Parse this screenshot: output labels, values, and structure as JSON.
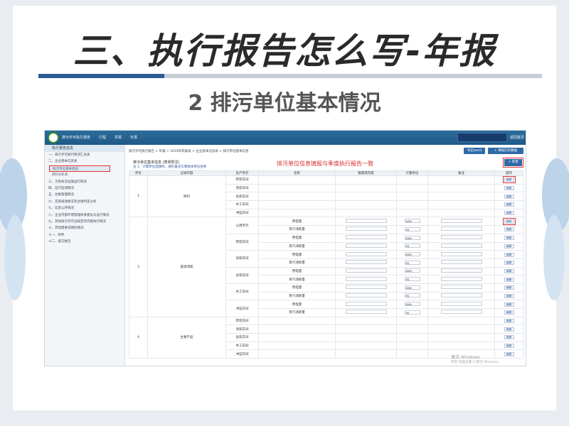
{
  "slide": {
    "title": "三、执行报告怎么写-年报",
    "subtitle": "2 排污单位基本情况"
  },
  "app": {
    "name": "排污许可执行报告",
    "nav": [
      "行程",
      "举报",
      "年报"
    ],
    "exit": "返回首页"
  },
  "sidebar": {
    "head": "执行报告信息",
    "items": [
      {
        "label": "一、排污许可执行情况汇总表",
        "sub": false,
        "selected": false
      },
      {
        "label": "二、企业基本信息表",
        "sub": false,
        "selected": false
      },
      {
        "label": "排污单位基本情况",
        "sub": true,
        "selected": true
      },
      {
        "label": "原料分析表",
        "sub": true,
        "selected": false
      },
      {
        "label": "三、污染防治设施运行情况",
        "sub": false,
        "selected": false
      },
      {
        "label": "四、自行监测情况",
        "sub": false,
        "selected": false
      },
      {
        "label": "五、台账管理情况",
        "sub": false,
        "selected": false
      },
      {
        "label": "六、实际排放情况及合规判定分析",
        "sub": false,
        "selected": false
      },
      {
        "label": "七、信息公开情况",
        "sub": false,
        "selected": false
      },
      {
        "label": "八、企业内部环境管理体系建设与运行情况",
        "sub": false,
        "selected": false
      },
      {
        "label": "九、其他排污许可证规定的内容执行情况",
        "sub": false,
        "selected": false
      },
      {
        "label": "十、其他需要说明的情况",
        "sub": false,
        "selected": false
      },
      {
        "label": "十一、附件",
        "sub": false,
        "selected": false
      },
      {
        "label": "十二、提交报告",
        "sub": false,
        "selected": false
      }
    ]
  },
  "content": {
    "breadcrumb": "排污许可执行报告 > 年报 > 2019年年报表 > 企业基本信息表 > 排污单位基本信息",
    "export_label": "导出word",
    "history_label": "+ 填报历史数据",
    "form_title": "排污单位基本信息 (表单附注)",
    "form_note": "注 1：计量单位选择时，请在备注写明具体单位名称",
    "annotation": "排污单位信息填报与季度执行报告一致",
    "add_label": "+ 新增",
    "headers": [
      "序号",
      "记录内容",
      "生产单元",
      "名称",
      "数量或内容",
      "计量单位",
      "备注",
      "操作"
    ],
    "edit_label": "编辑",
    "groups": [
      {
        "no": "1",
        "content": "原料",
        "units": [
          {
            "name": "焊装车间",
            "rows": [
              {
                "item": "",
                "unit": ""
              }
            ]
          },
          {
            "name": "涂装车间",
            "rows": [
              {
                "item": "",
                "unit": ""
              }
            ]
          },
          {
            "name": "总装车间",
            "rows": [
              {
                "item": "",
                "unit": ""
              }
            ]
          },
          {
            "name": "木工车间",
            "rows": [
              {
                "item": "",
                "unit": ""
              }
            ]
          },
          {
            "name": "冲压车间",
            "rows": [
              {
                "item": "",
                "unit": ""
              }
            ]
          }
        ]
      },
      {
        "no": "3",
        "content": "能源消耗",
        "units": [
          {
            "name": "公用单元",
            "rows": [
              {
                "item": "用电量",
                "unit": "KWh"
              },
              {
                "item": "蒸汽消耗量",
                "unit": "MJ"
              }
            ]
          },
          {
            "name": "焊装车间",
            "rows": [
              {
                "item": "用电量",
                "unit": "KWh"
              },
              {
                "item": "蒸汽消耗量",
                "unit": "MJ"
              }
            ]
          },
          {
            "name": "涂装车间",
            "rows": [
              {
                "item": "用电量",
                "unit": "KWh"
              },
              {
                "item": "蒸汽消耗量",
                "unit": "MJ"
              }
            ]
          },
          {
            "name": "总装车间",
            "rows": [
              {
                "item": "用电量",
                "unit": "KWh"
              },
              {
                "item": "蒸汽消耗量",
                "unit": "MJ"
              }
            ]
          },
          {
            "name": "木工车间",
            "rows": [
              {
                "item": "用电量",
                "unit": "KWh"
              },
              {
                "item": "蒸汽消耗量",
                "unit": "MJ"
              }
            ]
          },
          {
            "name": "冲压车间",
            "rows": [
              {
                "item": "用电量",
                "unit": "KWh"
              },
              {
                "item": "蒸汽消耗量",
                "unit": "MJ"
              }
            ]
          }
        ]
      },
      {
        "no": "4",
        "content": "主要产品",
        "units": [
          {
            "name": "焊装车间",
            "rows": [
              {
                "item": "",
                "unit": ""
              }
            ]
          },
          {
            "name": "涂装车间",
            "rows": [
              {
                "item": "",
                "unit": ""
              }
            ]
          },
          {
            "name": "总装车间",
            "rows": [
              {
                "item": "",
                "unit": ""
              }
            ]
          },
          {
            "name": "木工车间",
            "rows": [
              {
                "item": "",
                "unit": ""
              }
            ]
          },
          {
            "name": "冲压车间",
            "rows": [
              {
                "item": "",
                "unit": ""
              }
            ]
          }
        ]
      }
    ]
  },
  "watermark": {
    "line1": "激活 Windows",
    "line2": "转到\"电脑设置\"以激活 Windows。"
  }
}
